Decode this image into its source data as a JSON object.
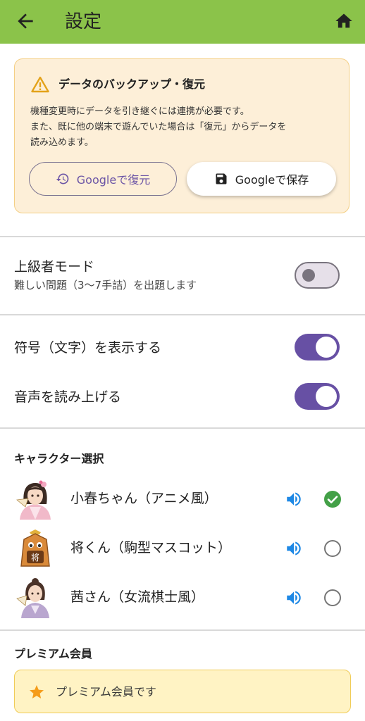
{
  "appbar": {
    "title": "設定",
    "color": "#8bc34a",
    "back_icon": "arrow-left-icon",
    "home_icon": "home-icon"
  },
  "backup": {
    "title": "データのバックアップ・復元",
    "line1": "機種変更時にデータを引き継ぐには連携が必要です。",
    "line2": "また、既に他の端末で遊んでいた場合は「復元」からデータを",
    "line3": "読み込めます。",
    "restore_label": "Googleで復元",
    "save_label": "Googleで保存",
    "warning_icon": "warning-icon",
    "restore_icon": "history-icon",
    "save_icon": "floppy-disk-icon"
  },
  "settings": {
    "advanced_label": "上級者モード",
    "advanced_sub": "難しい問題（3〜7手詰）を出題します",
    "advanced_on": false,
    "notation_label": "符号（文字）を表示する",
    "notation_on": true,
    "voice_label": "音声を読み上げる",
    "voice_on": true,
    "toggle_color": "#6750a4"
  },
  "characters": {
    "heading": "キャラクター選択",
    "items": [
      {
        "name": "小春ちゃん（アニメ風）",
        "selected": true
      },
      {
        "name": "将くん（駒型マスコット）",
        "selected": false
      },
      {
        "name": "茜さん（女流棋士風）",
        "selected": false
      }
    ],
    "speaker_icon": "speaker-icon",
    "speaker_color": "#1e88e5",
    "check_color": "#43a047",
    "mascot_badge": "将"
  },
  "premium": {
    "heading": "プレミアム会員",
    "status": "プレミアム会員です",
    "star_icon": "star-icon",
    "star_color": "#f59c1a"
  }
}
